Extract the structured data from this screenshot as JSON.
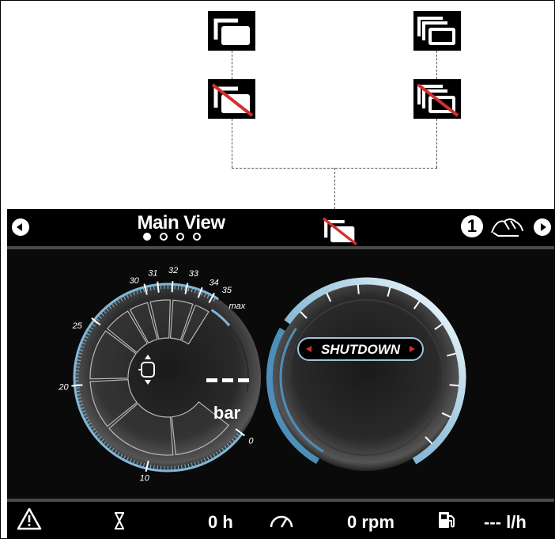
{
  "legend": {
    "icons": [
      "multi-window-icon",
      "multi-window-layered-icon",
      "multi-window-off-icon",
      "multi-window-layered-off-icon"
    ]
  },
  "header": {
    "title": "Main View",
    "page_count": 4,
    "active_page": 1,
    "center_icon": "multi-window-off-icon",
    "station_number": "1",
    "station_icon": "hand-helm-icon"
  },
  "pressure_gauge": {
    "unit": "bar",
    "value": "---",
    "scale_labels": [
      "0",
      "10",
      "20",
      "25",
      "30",
      "31",
      "32",
      "33",
      "34",
      "35"
    ],
    "max_label": "max",
    "accent_color": "#7fb8d8"
  },
  "rpm_gauge": {
    "status": "SHUTDOWN",
    "status_marker_color": "#d03030"
  },
  "footer": {
    "warning_icon": "warning-triangle-icon",
    "hours_icon": "hourglass-icon",
    "hours_value": "0 h",
    "speed_icon": "speedometer-icon",
    "rpm_value": "0 rpm",
    "fuel_icon": "fuel-pump-icon",
    "fuel_rate_value": "--- l/h"
  }
}
